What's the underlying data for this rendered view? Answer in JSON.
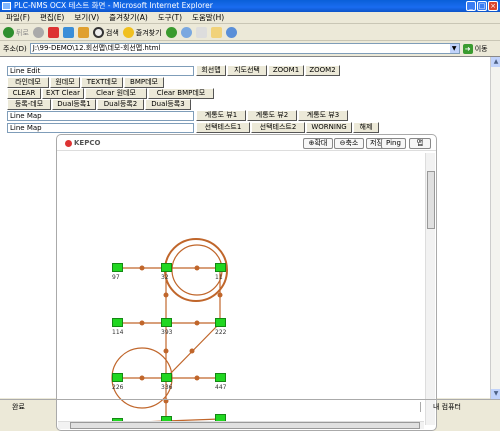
{
  "window": {
    "title": "PLC-NMS OCX 테스트 화면 - Microsoft Internet Explorer"
  },
  "menu": [
    "파일(F)",
    "편집(E)",
    "보기(V)",
    "즐겨찾기(A)",
    "도구(T)",
    "도움말(H)"
  ],
  "toolbar": {
    "back": "뒤로",
    "search": "검색",
    "favorites": "즐겨찾기"
  },
  "address": {
    "label": "주소(D)",
    "url": "J:\\99-DEMO\\12.회선맵\\데모-회선맵.html",
    "go": "이동"
  },
  "controls": {
    "line_edit_value": "Line Edit",
    "line_map_value_1": "Line Map",
    "line_map_value_2": "Line Map",
    "buttons": [
      "회선맵",
      "지도선택",
      "ZOOM1",
      "ZOOM2",
      "라인데모",
      "원데모",
      "TEXT데모",
      "BMP데모",
      "CLEAR",
      "EXT Clear",
      "Clear 원데모",
      "Clear BMP데모",
      "등록-데모",
      "Dual등록1",
      "Dual등록2",
      "Dual등록3",
      "계통도 뷰1",
      "계통도 뷰2",
      "계통도 뷰3",
      "선택테스트1",
      "선택테스트2",
      "WORNING",
      "해제"
    ]
  },
  "ocx": {
    "logo": "KEPCO",
    "buttons": [
      "확대",
      "축소",
      "저장",
      "Ping",
      "맵"
    ],
    "node_labels": [
      "97",
      "32",
      "11",
      "114",
      "393",
      "222",
      "226",
      "336",
      "447"
    ]
  },
  "status": {
    "left": "완료",
    "right": "내 컴퓨터"
  }
}
